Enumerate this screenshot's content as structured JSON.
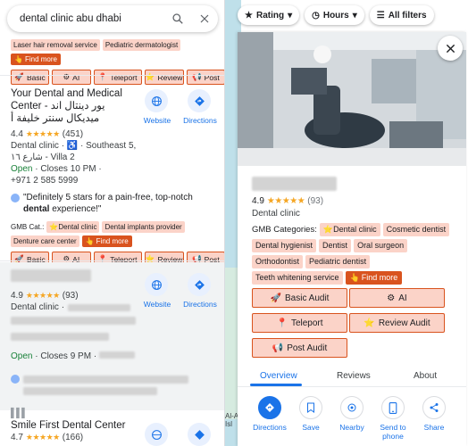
{
  "search": {
    "query": "dental clinic abu dhabi"
  },
  "filters": {
    "rating": "Rating",
    "hours": "Hours",
    "all_filters": "All filters"
  },
  "audit_buttons": {
    "basic": "Basic",
    "ai": "AI",
    "teleport": "Teleport",
    "review": "Review",
    "post": "Post"
  },
  "find_more": "Find more",
  "top_partial": {
    "tags": [
      "Laser hair removal service",
      "Pediatric dermatologist"
    ]
  },
  "result1": {
    "name": "Your Dental and Medical Center - يور دينتال اند ميديكال سنتر خليفة أ",
    "rating": "4.4",
    "reviews": "(451)",
    "category": "Dental clinic · ♿ · Southeast 5,",
    "address2": "شارع ١٦ - Villa 2",
    "status_open": "Open",
    "status_close": "· Closes 10 PM ·",
    "phone": "+971 2 585 5999",
    "review_pre": "\"Definitely 5 stars for a pain-free, top-notch ",
    "review_bold": "dental",
    "review_post": " experience!\"",
    "gmb_label": "GMB Cat.:",
    "tags": [
      "Dental clinic",
      "Dental implants provider",
      "Denture care center"
    ],
    "website": "Website",
    "directions": "Directions"
  },
  "result2": {
    "rating": "4.9",
    "reviews": "(93)",
    "category": "Dental clinic ·",
    "status_open": "Open",
    "status_close": "· Closes 9 PM ·",
    "website": "Website",
    "directions": "Directions"
  },
  "result3": {
    "name": "Smile First Dental Center",
    "rating": "4.7",
    "reviews": "(166)"
  },
  "map_label": "Al-A Isl",
  "detail": {
    "rating": "4.9",
    "reviews": "(93)",
    "category": "Dental clinic",
    "gmb_label": "GMB Categories:",
    "tags": [
      "Dental clinic",
      "Cosmetic dentist",
      "Dental hygienist",
      "Dentist",
      "Oral surgeon",
      "Orthodontist",
      "Pediatric dentist",
      "Teeth whitening service"
    ],
    "buttons": {
      "basic_audit": "Basic Audit",
      "ai": "AI",
      "teleport": "Teleport",
      "review_audit": "Review Audit",
      "post_audit": "Post Audit"
    },
    "tabs": [
      "Overview",
      "Reviews",
      "About"
    ],
    "actions": [
      "Directions",
      "Save",
      "Nearby",
      "Send to phone",
      "Share"
    ]
  },
  "colors": {
    "accent": "#1a73e8",
    "audit_bg": "#fbd3c8",
    "audit_border": "#d9531e",
    "open": "#188038",
    "star": "#f5a623"
  }
}
